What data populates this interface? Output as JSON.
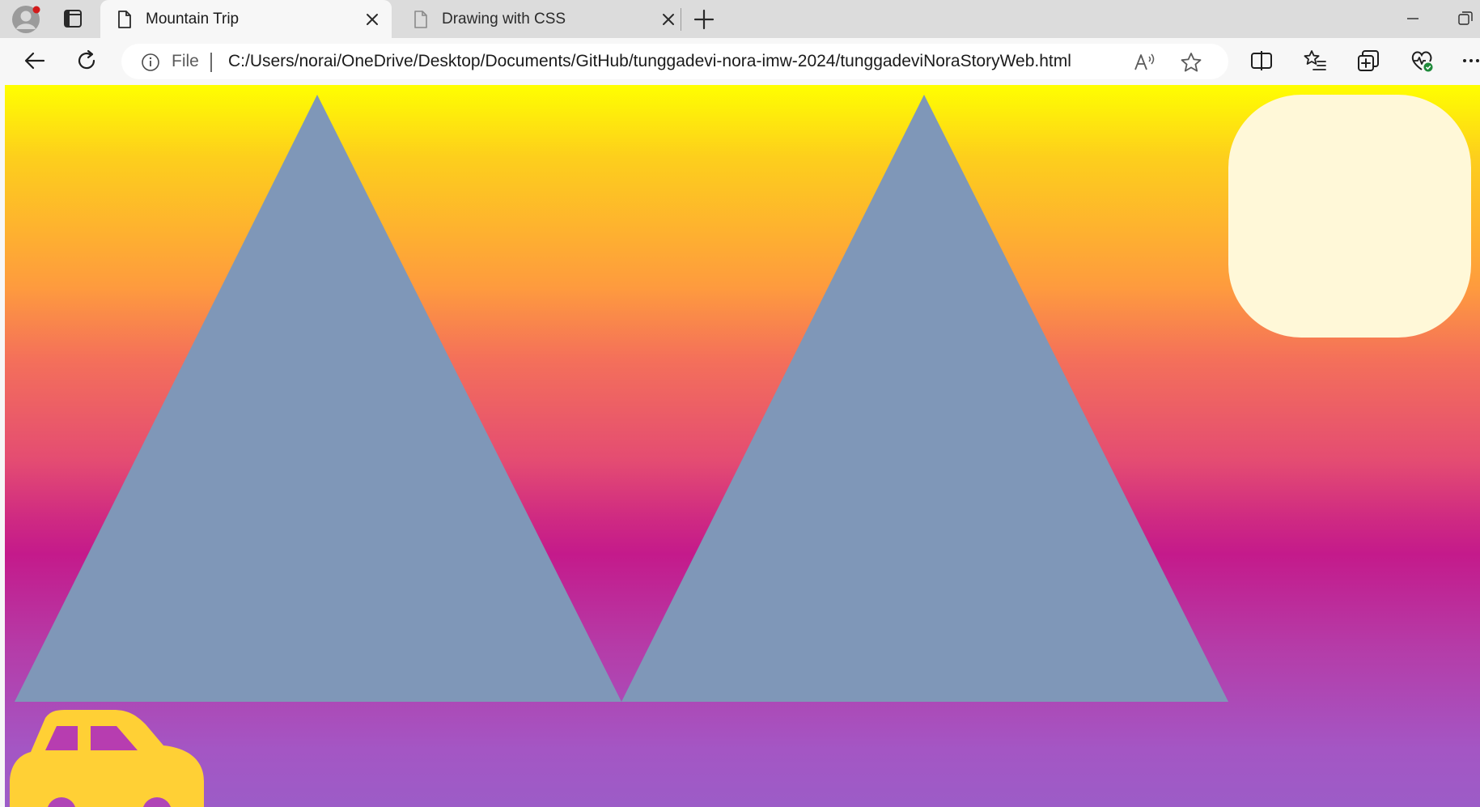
{
  "tabs": [
    {
      "title": "Mountain Trip",
      "active": true
    },
    {
      "title": "Drawing with CSS",
      "active": false
    }
  ],
  "address_bar": {
    "scheme": "File",
    "url": "C:/Users/norai/OneDrive/Desktop/Documents/GitHub/tunggadevi-nora-imw-2024/tunggadeviNoraStoryWeb.html"
  },
  "icons": {
    "profile": "profile-avatar-icon",
    "tab_actions": "tab-actions-icon",
    "page": "page-icon",
    "close": "close-icon",
    "new_tab": "plus-icon",
    "back": "back-arrow-icon",
    "refresh": "refresh-icon",
    "info": "info-icon",
    "read_aloud": "read-aloud-icon",
    "favorite": "star-icon",
    "split_screen": "split-screen-icon",
    "favorites": "favorites-icon",
    "collections": "collections-icon",
    "performance": "browser-essentials-icon",
    "more": "more-icon"
  },
  "scene": {
    "sky_gradient": [
      "#ffff00",
      "#fe9b3e",
      "#f4705a",
      "#c41a8b",
      "#9c5cc7"
    ],
    "mountain_color": "#7f97b8",
    "sun_color": "#fff8d8",
    "car_color": "#ffd035"
  }
}
